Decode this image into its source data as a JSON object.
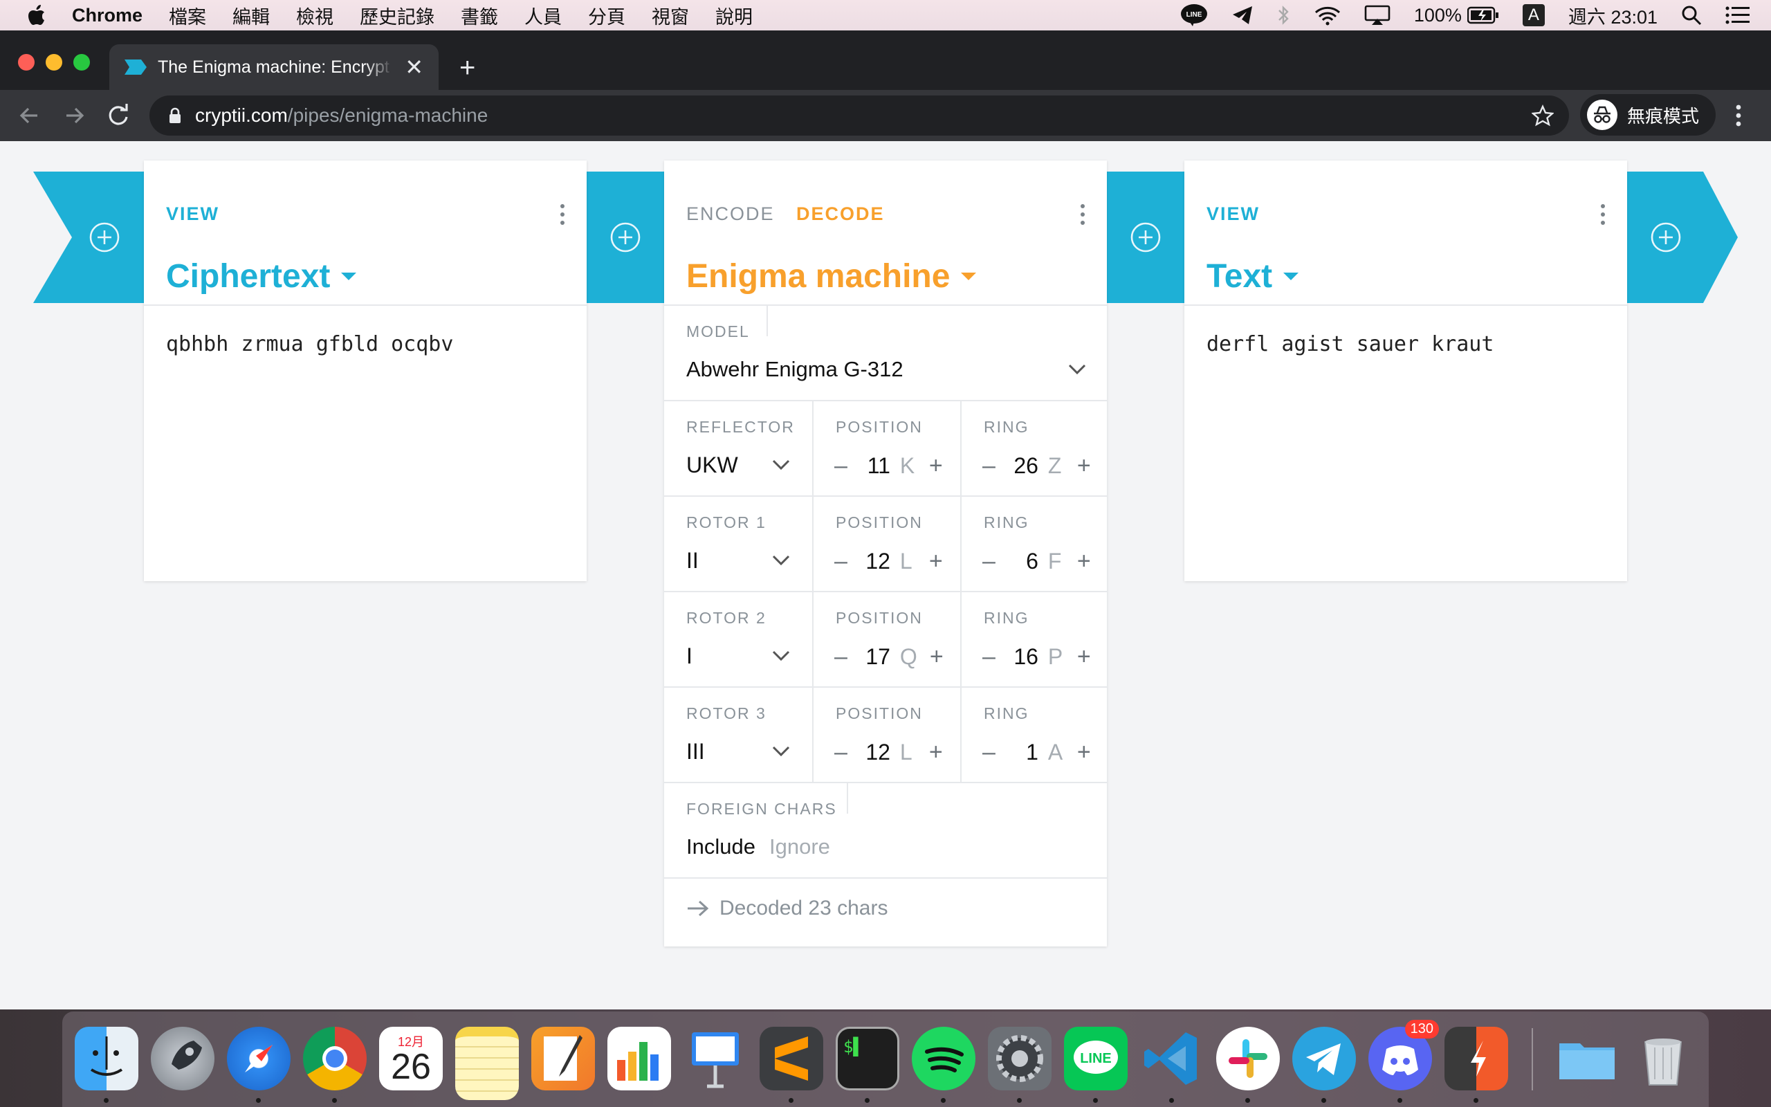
{
  "menubar": {
    "app": "Chrome",
    "items": [
      "檔案",
      "編輯",
      "檢視",
      "歷史記錄",
      "書籤",
      "人員",
      "分頁",
      "視窗",
      "說明"
    ],
    "battery": "100%",
    "input_indicator": "A",
    "clock": "週六 23:01"
  },
  "browser": {
    "tab_title": "The Enigma machine: Encrypt and decrypt online – Cryptii",
    "url_host": "cryptii.com",
    "url_path": "/pipes/enigma-machine",
    "profile_label": "無痕模式"
  },
  "bricks": {
    "left": {
      "mode": "VIEW",
      "title": "Ciphertext",
      "content": "qbhbh zrmua gfbld ocqbv"
    },
    "middle": {
      "mode_encode": "ENCODE",
      "mode_decode": "DECODE",
      "title": "Enigma machine",
      "model_label": "MODEL",
      "model_value": "Abwehr Enigma G-312",
      "rows": [
        {
          "label": "REFLECTOR",
          "value": "UKW",
          "pos_label": "POSITION",
          "pos_num": "11",
          "pos_letter": "K",
          "ring_label": "RING",
          "ring_num": "26",
          "ring_letter": "Z"
        },
        {
          "label": "ROTOR 1",
          "value": "II",
          "pos_label": "POSITION",
          "pos_num": "12",
          "pos_letter": "L",
          "ring_label": "RING",
          "ring_num": "6",
          "ring_letter": "F"
        },
        {
          "label": "ROTOR 2",
          "value": "I",
          "pos_label": "POSITION",
          "pos_num": "17",
          "pos_letter": "Q",
          "ring_label": "RING",
          "ring_num": "16",
          "ring_letter": "P"
        },
        {
          "label": "ROTOR 3",
          "value": "III",
          "pos_label": "POSITION",
          "pos_num": "12",
          "pos_letter": "L",
          "ring_label": "RING",
          "ring_num": "1",
          "ring_letter": "A"
        }
      ],
      "minus_symbol": "–",
      "plus_symbol": "+",
      "foreign_label": "FOREIGN CHARS",
      "foreign_include": "Include",
      "foreign_ignore": "Ignore",
      "status": "Decoded 23 chars"
    },
    "right": {
      "mode": "VIEW",
      "title": "Text",
      "content": "derfl agist sauer kraut"
    }
  },
  "dock": {
    "calendar_month": "12月",
    "calendar_day": "26",
    "discord_badge": "130"
  },
  "colors": {
    "accent_blue": "#1eb0d6",
    "accent_orange": "#f8a02c"
  }
}
